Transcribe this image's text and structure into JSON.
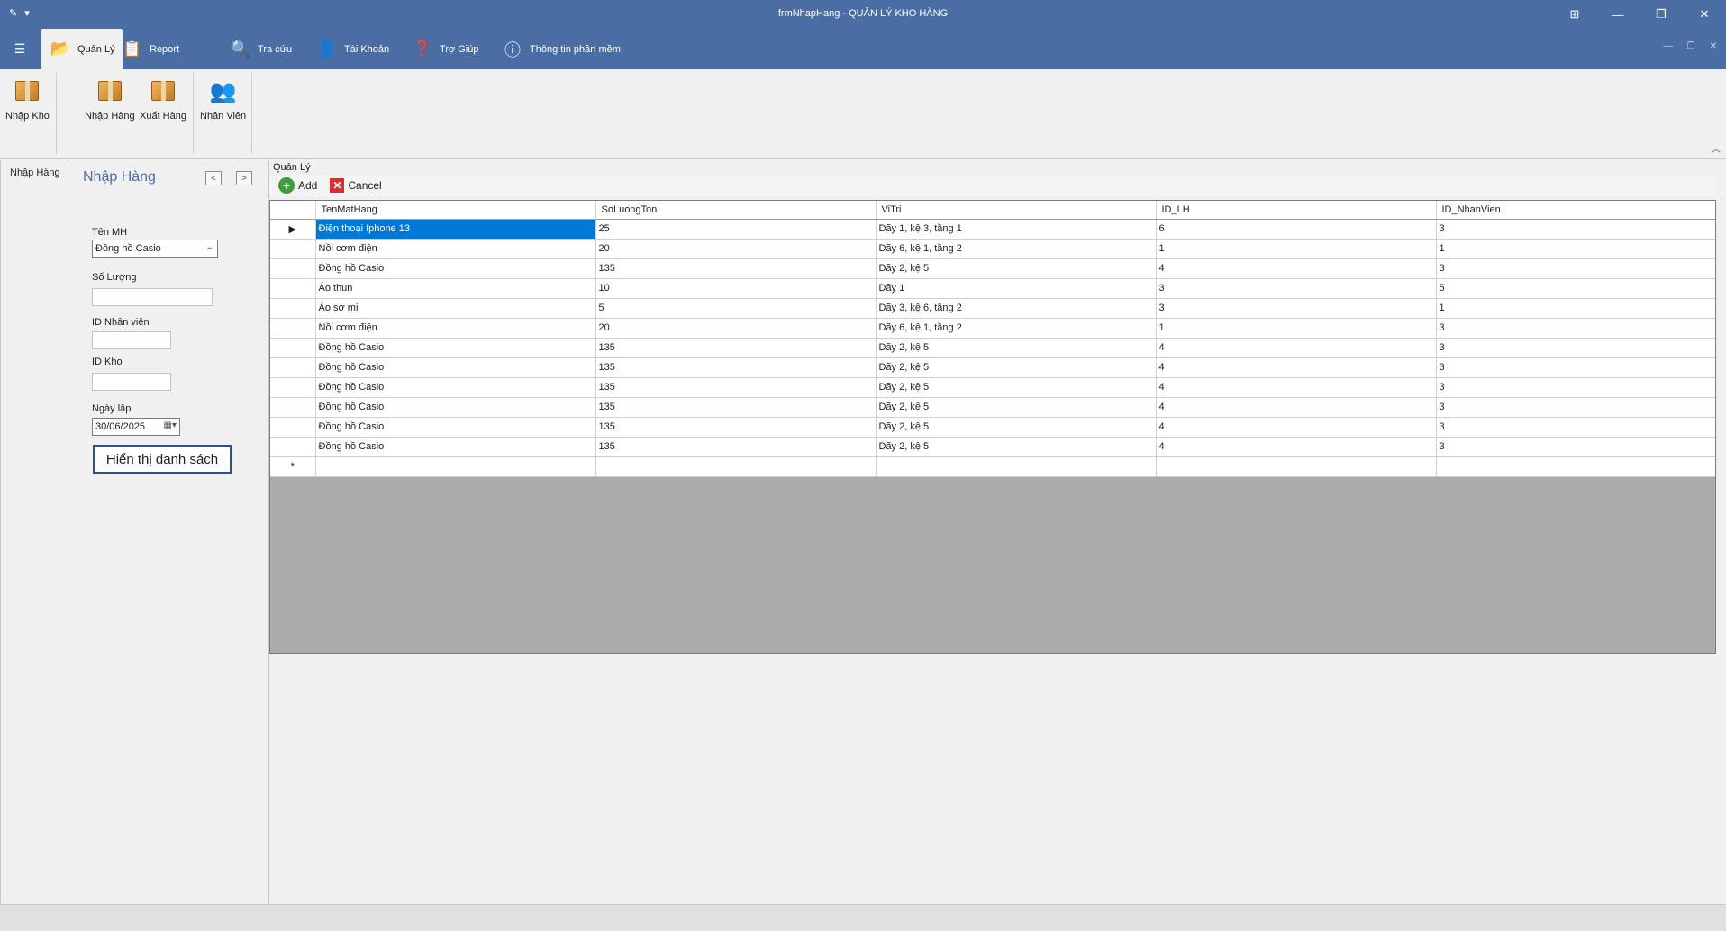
{
  "window": {
    "title": "frmNhapHang - QUẢN LÝ KHO HÀNG",
    "controls": [
      "⊞",
      "—",
      "❐",
      "✕"
    ]
  },
  "ribbon": {
    "tabs": [
      "Quản Lý",
      "Report",
      "Tra cứu",
      "Tài Khoản",
      "Trợ Giúp",
      "Thông tin phần mềm"
    ],
    "buttons": [
      "Nhập Kho",
      "Nhập Hàng",
      "Xuất Hàng",
      "Nhân Viên"
    ]
  },
  "leftnav": {
    "item": "Nhập Hàng"
  },
  "form": {
    "title": "Nhập Hàng",
    "ten_mh_label": "Tên MH",
    "ten_mh_value": "Đồng hồ Casio",
    "so_luong_label": "Số Lượng",
    "so_luong_value": "",
    "id_nhanvien_label": "ID Nhân viên",
    "id_nhanvien_value": "",
    "id_kho_label": "ID Kho",
    "id_kho_value": "",
    "ngay_lap_label": "Ngày lập",
    "ngay_lap_value": "30/06/2025",
    "show_button": "Hiển thị danh sách"
  },
  "main": {
    "group_title": "Quản Lý",
    "add_label": "Add",
    "cancel_label": "Cancel"
  },
  "grid": {
    "columns": [
      "TenMatHang",
      "SoLuongTon",
      "ViTri",
      "ID_LH",
      "ID_NhanVien"
    ],
    "rows": [
      [
        "Điện thoại Iphone 13",
        "25",
        "Dãy 1, kệ 3, tầng 1",
        "6",
        "3"
      ],
      [
        "Nồi cơm điện",
        "20",
        "Dãy 6, kệ 1, tầng 2",
        "1",
        "1"
      ],
      [
        "Đồng hồ Casio",
        "135",
        "Dãy 2, kệ 5",
        "4",
        "3"
      ],
      [
        "Áo thun",
        "10",
        "Dãy 1",
        "3",
        "5"
      ],
      [
        "Áo sơ mi",
        "5",
        "Dãy 3, kệ 6, tầng 2",
        "3",
        "1"
      ],
      [
        "Nồi cơm điện",
        "20",
        "Dãy 6, kệ 1, tầng 2",
        "1",
        "3"
      ],
      [
        "Đồng hồ Casio",
        "135",
        "Dãy 2, kệ 5",
        "4",
        "3"
      ],
      [
        "Đồng hồ Casio",
        "135",
        "Dãy 2, kệ 5",
        "4",
        "3"
      ],
      [
        "Đồng hồ Casio",
        "135",
        "Dãy 2, kệ 5",
        "4",
        "3"
      ],
      [
        "Đồng hồ Casio",
        "135",
        "Dãy 2, kệ 5",
        "4",
        "3"
      ],
      [
        "Đồng hồ Casio",
        "135",
        "Dãy 2, kệ 5",
        "4",
        "3"
      ],
      [
        "Đồng hồ Casio",
        "135",
        "Dãy 2, kệ 5",
        "4",
        "3"
      ]
    ],
    "current_marker": "▶",
    "new_row_marker": "*"
  }
}
